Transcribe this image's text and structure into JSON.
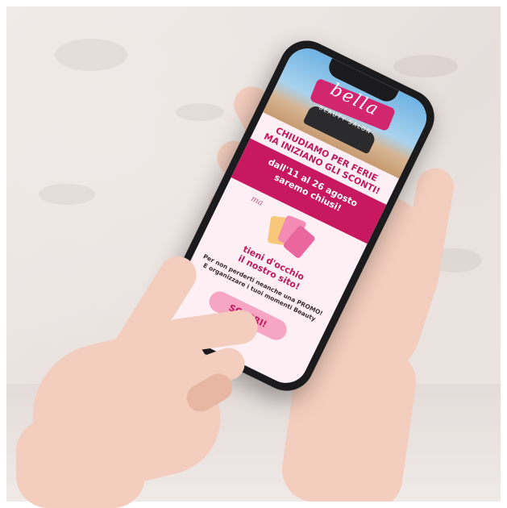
{
  "promo": {
    "logo_word": "bella",
    "logo_sub": "BEAUTY SALON",
    "headline_line1": "CHIUDIAMO PER FERIE",
    "headline_line2": "MA INIZIANO GLI SCONTI!",
    "dates_line1": "dall'11 al 26 agosto",
    "dates_line2": "saremo chiusi!",
    "ma": "ma",
    "subhead_line1": "tieni d'occhio",
    "subhead_line2": "il nostro sito!",
    "body_line1": "Per non perderti neanche una PROMO!",
    "body_line2": "E organizzare i tuoi momenti Beauty",
    "cta_label": "SCOPRI!"
  },
  "colors": {
    "brand_magenta": "#c8185f",
    "cta_pink": "#f6a6c3",
    "screen_background": "#fdeff3"
  }
}
